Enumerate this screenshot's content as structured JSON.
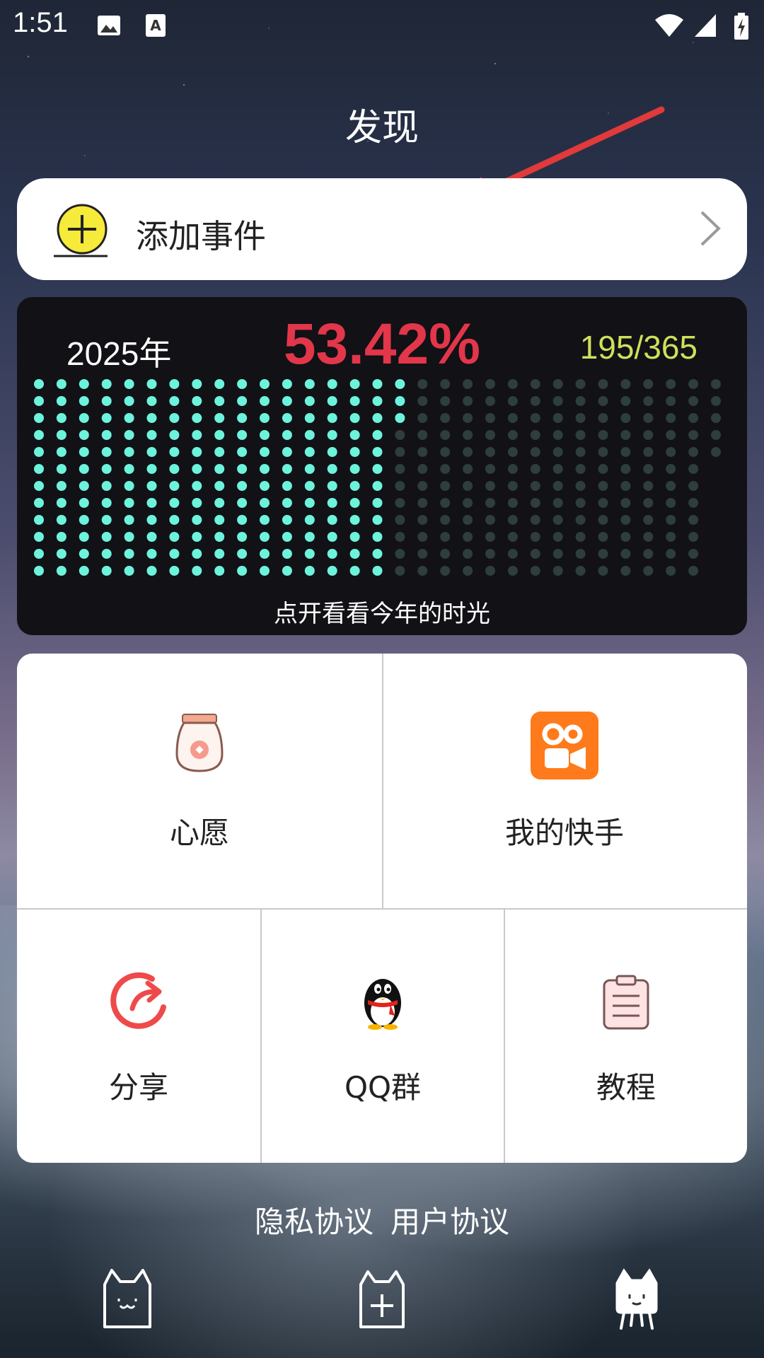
{
  "status_bar": {
    "time": "1:51"
  },
  "page_title": "发现",
  "add_event": {
    "label": "添加事件"
  },
  "year_progress": {
    "year": "2025年",
    "percent": "53.42%",
    "days": "195/365",
    "days_passed": 195,
    "days_total": 365,
    "caption": "点开看看今年的时光"
  },
  "menu": {
    "wish": "心愿",
    "kuaishou": "我的快手",
    "share": "分享",
    "qq_group": "QQ群",
    "tutorial": "教程"
  },
  "footer": {
    "privacy": "隐私协议",
    "user_agreement": "用户协议"
  },
  "colors": {
    "accent_red": "#e2364a",
    "dot_active": "#6df3dc",
    "dot_inactive": "#2e3d3d",
    "days_yellow": "#cfe05a"
  }
}
